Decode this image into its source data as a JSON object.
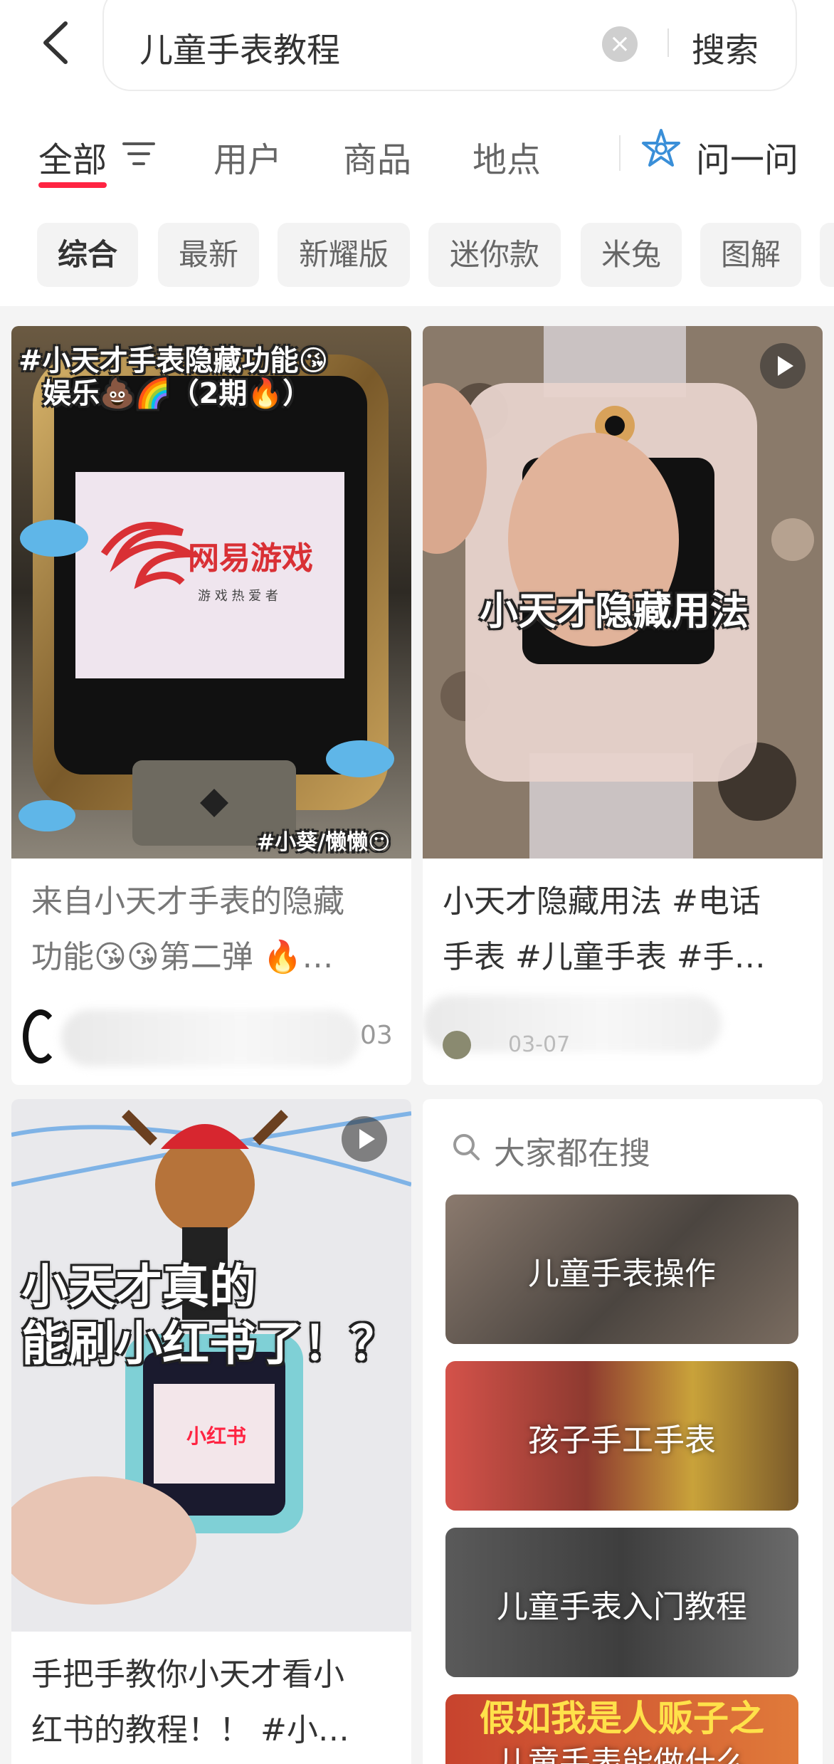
{
  "search": {
    "query": "儿童手表教程",
    "submit_label": "搜索"
  },
  "tabs": [
    {
      "label": "全部",
      "active": true
    },
    {
      "label": "用户",
      "active": false
    },
    {
      "label": "商品",
      "active": false
    },
    {
      "label": "地点",
      "active": false
    }
  ],
  "ask_label": "问一问",
  "chips": [
    {
      "label": "综合",
      "active": true
    },
    {
      "label": "最新"
    },
    {
      "label": "新耀版"
    },
    {
      "label": "迷你款"
    },
    {
      "label": "米兔"
    },
    {
      "label": "图解"
    }
  ],
  "cards": [
    {
      "overlay_top": "#小天才手表隐藏功能😘",
      "overlay_top2": "娱乐💩🌈（2期🔥）",
      "screen_logo": "网易游戏",
      "screen_sub": "游 戏 热 爱 者",
      "overlay_bottom": "#小葵/懒懒😶",
      "title_line1": "来自小天才手表的隐藏",
      "title_line2": "功能😘😘第二弹 🔥…",
      "meta_partial": "03"
    },
    {
      "overlay_center": "小天才隐藏用法",
      "title_line1": "小天才隐藏用法 #电话",
      "title_line2": "手表 #儿童手表 #手…",
      "meta_partial": "03-07"
    },
    {
      "overlay_line1": "小天才真的",
      "overlay_line2": "能刷小红书了！？",
      "screen_logo": "小红书",
      "title_line1": "手把手教你小天才看小",
      "title_line2": "红书的教程！！ #小…"
    }
  ],
  "suggestions": {
    "heading": "大家都在搜",
    "items": [
      {
        "label": "儿童手表操作"
      },
      {
        "label": "孩子手工手表"
      },
      {
        "label": "儿童手表入门教程"
      },
      {
        "label": "儿童手表能做什么"
      }
    ],
    "peek_text": "假如我是人贩子之"
  },
  "colors": {
    "accent": "#ff2442",
    "background": "#f4f4f4",
    "card": "#ffffff"
  }
}
